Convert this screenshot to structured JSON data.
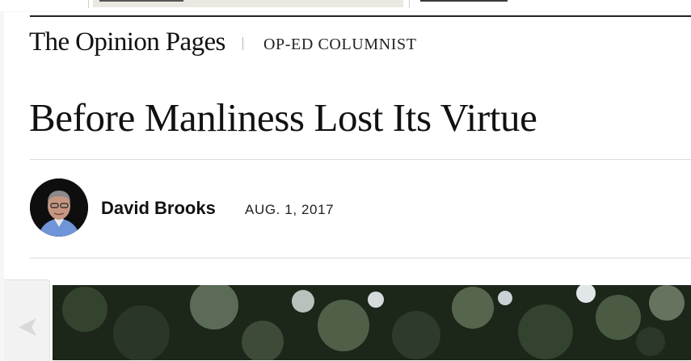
{
  "header": {
    "section_title": "The Opinion Pages",
    "kicker": "OP-ED COLUMNIST"
  },
  "article": {
    "headline": "Before Manliness Lost Its Virtue",
    "author": "David Brooks",
    "date": "AUG. 1, 2017"
  },
  "icons": {
    "previous": "chevron-left-icon"
  },
  "colors": {
    "text": "#111111",
    "rule": "#dcdcdc",
    "background": "#ffffff"
  }
}
